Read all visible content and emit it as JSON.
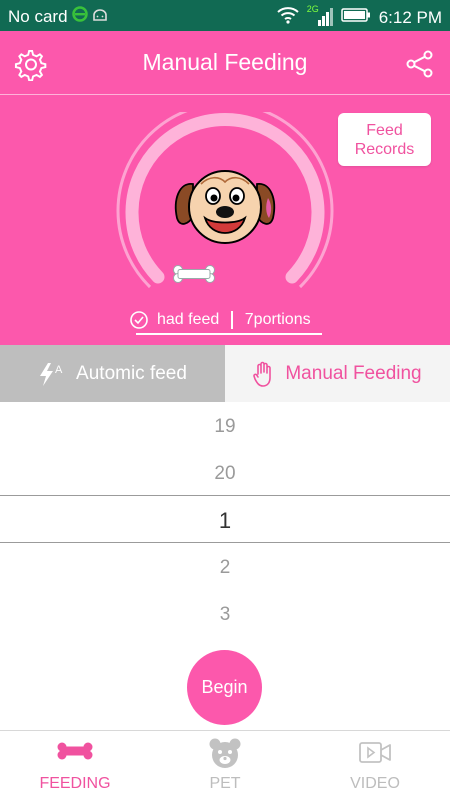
{
  "status_bar": {
    "carrier": "No card",
    "network": "2G",
    "time": "6:12 PM"
  },
  "header": {
    "title": "Manual Feeding"
  },
  "feed_records": {
    "line1": "Feed",
    "line2": "Records"
  },
  "feed_status": {
    "label": "had feed",
    "portions": "7portions"
  },
  "modes": {
    "auto_label": "Automic feed",
    "manual_label": "Manual Feeding"
  },
  "picker": {
    "items": [
      "19",
      "20",
      "1",
      "2",
      "3"
    ],
    "selected": "1"
  },
  "begin_label": "Begin",
  "bottom_nav": {
    "feeding": "FEEDING",
    "pet": "PET",
    "video": "VIDEO"
  },
  "colors": {
    "accent": "#fc58ac",
    "status_bar": "#116a53",
    "inactive_tab": "#bebebe"
  }
}
